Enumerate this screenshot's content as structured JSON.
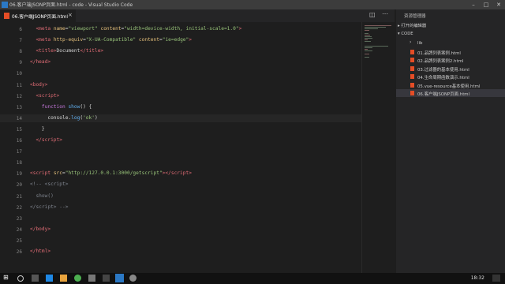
{
  "window": {
    "title": "06.客户端JSONP页面.html - code - Visual Studio Code"
  },
  "tab": {
    "label": "06.客户端JSONP页面.html"
  },
  "editor": {
    "lines": [
      {
        "n": "6",
        "html": "  <span class=\"tag\">&lt;meta</span> <span class=\"attr\">name</span>=<span class=\"str\">\"viewport\"</span> <span class=\"attr\">content</span>=<span class=\"str\">\"width=device-width, initial-scale=1.0\"</span><span class=\"tag\">&gt;</span>"
      },
      {
        "n": "7",
        "html": "  <span class=\"tag\">&lt;meta</span> <span class=\"attr\">http-equiv</span>=<span class=\"str\">\"X-UA-Compatible\"</span> <span class=\"attr\">content</span>=<span class=\"str\">\"ie=edge\"</span><span class=\"tag\">&gt;</span>"
      },
      {
        "n": "8",
        "html": "  <span class=\"tag\">&lt;title&gt;</span>Document<span class=\"tag\">&lt;/title&gt;</span>"
      },
      {
        "n": "9",
        "html": "<span class=\"tag\">&lt;/head&gt;</span>"
      },
      {
        "n": "10",
        "html": ""
      },
      {
        "n": "11",
        "html": "<span class=\"tag\">&lt;body&gt;</span>"
      },
      {
        "n": "12",
        "html": "  <span class=\"tag\">&lt;script&gt;</span>"
      },
      {
        "n": "13",
        "html": "    <span class=\"kw\">function</span> <span class=\"fn\">show</span>() {"
      },
      {
        "n": "14",
        "html": "      console.<span class=\"fn\">log</span>(<span class=\"str\">'ok'</span>)",
        "cur": true
      },
      {
        "n": "15",
        "html": "    }"
      },
      {
        "n": "16",
        "html": "  <span class=\"tag\">&lt;/script&gt;</span>"
      },
      {
        "n": "17",
        "html": ""
      },
      {
        "n": "18",
        "html": ""
      },
      {
        "n": "19",
        "html": "<span class=\"tag\">&lt;script</span> <span class=\"attr\">src</span>=<span class=\"str\">\"http://127.0.0.1:3000/getscript\"</span><span class=\"tag\">&gt;&lt;/script&gt;</span>"
      },
      {
        "n": "20",
        "html": "<span class=\"cm\">&lt;!-- &lt;script&gt;</span>"
      },
      {
        "n": "21",
        "html": "<span class=\"cm\">  show()</span>"
      },
      {
        "n": "22",
        "html": "<span class=\"cm\">&lt;/script&gt; --&gt;</span>"
      },
      {
        "n": "23",
        "html": ""
      },
      {
        "n": "24",
        "html": "<span class=\"tag\">&lt;/body&gt;</span>"
      },
      {
        "n": "25",
        "html": ""
      },
      {
        "n": "26",
        "html": "<span class=\"tag\">&lt;/html&gt;</span>"
      }
    ]
  },
  "sidebar": {
    "header": "资源管理器",
    "open_editors": "打开的编辑器",
    "folder": "CODE",
    "items": [
      {
        "label": "lib",
        "folder": true
      },
      {
        "label": "01.品牌列表案例.html"
      },
      {
        "label": "02.品牌列表案例2.html"
      },
      {
        "label": "03.过滤器的基本使用.html"
      },
      {
        "label": "04.生命周期函数演示.html"
      },
      {
        "label": "05.vue-resource基本使用.html"
      },
      {
        "label": "06.客户端JSONP页面.html",
        "selected": true
      }
    ]
  },
  "taskbar": {
    "time": "18:32"
  }
}
